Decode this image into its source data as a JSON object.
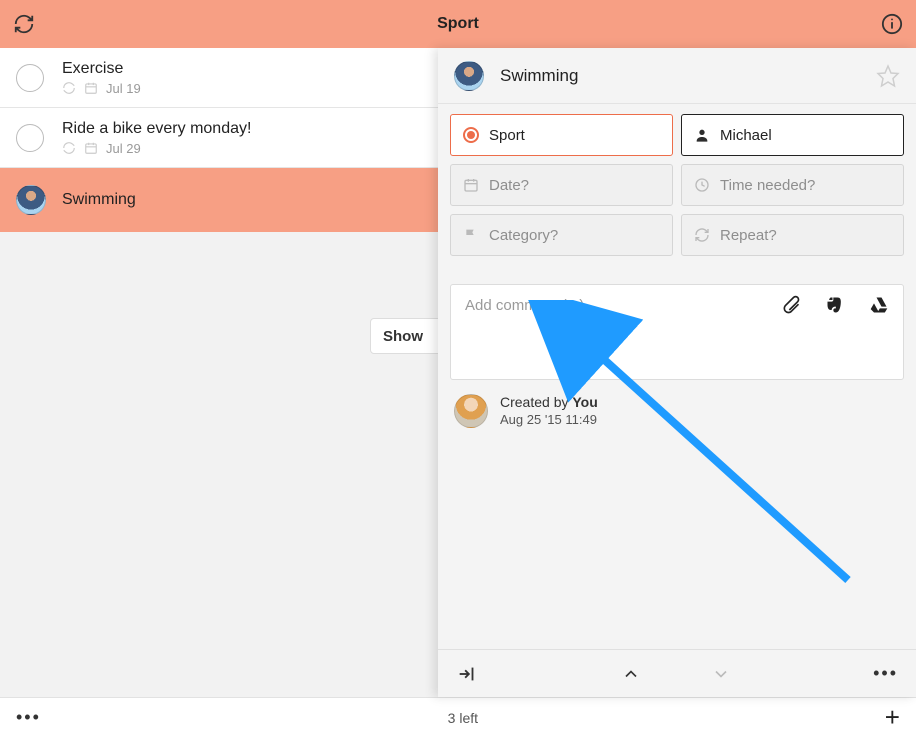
{
  "header": {
    "title": "Sport"
  },
  "tasks": [
    {
      "title": "Exercise",
      "date": "Jul 19"
    },
    {
      "title": "Ride a bike every monday!",
      "date": "Jul 29"
    },
    {
      "title": "Swimming"
    }
  ],
  "showmore_label": "Show",
  "footer": {
    "count_label": "3 left"
  },
  "detail": {
    "title": "Swimming",
    "list_label": "Sport",
    "assignee": "Michael",
    "date_placeholder": "Date?",
    "time_placeholder": "Time needed?",
    "category_placeholder": "Category?",
    "repeat_placeholder": "Repeat?",
    "comment_placeholder": "Add comment (↩)",
    "created_by_prefix": "Created by ",
    "created_by_who": "You",
    "created_date": "Aug 25 '15 11:49"
  }
}
